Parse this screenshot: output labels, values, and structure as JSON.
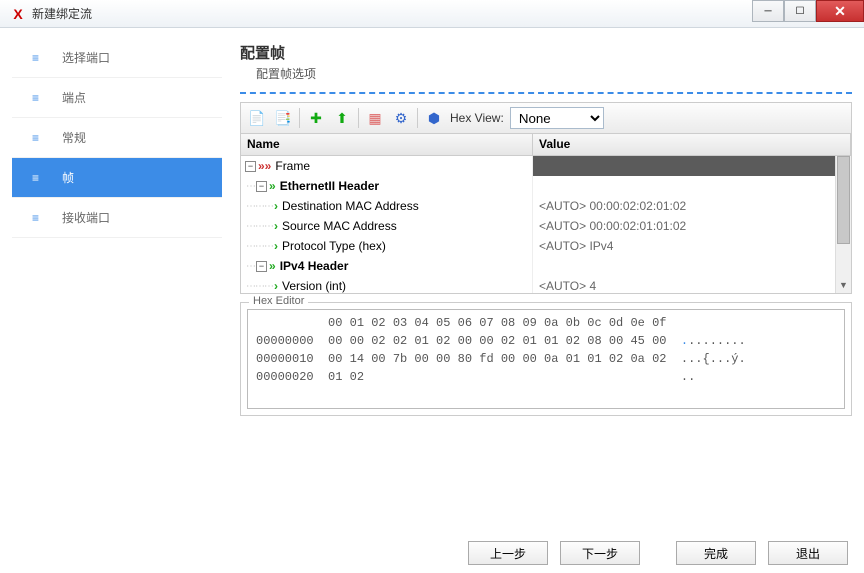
{
  "title": "新建绑定流",
  "sidebar": {
    "items": [
      {
        "label": "选择端口"
      },
      {
        "label": "端点"
      },
      {
        "label": "常规"
      },
      {
        "label": "帧"
      },
      {
        "label": "接收端口"
      }
    ],
    "active_index": 3
  },
  "main": {
    "title": "配置帧",
    "subtitle": "配置帧选项",
    "hexview_label": "Hex View:",
    "hexview_value": "None"
  },
  "tree": {
    "headers": {
      "name": "Name",
      "value": "Value"
    },
    "rows": [
      {
        "depth": 0,
        "exp": "-",
        "arrow": "red",
        "label": "Frame",
        "bold": false,
        "value": "",
        "selected": true
      },
      {
        "depth": 1,
        "exp": "-",
        "arrow": "green",
        "label": "EthernetII Header",
        "bold": true,
        "value": ""
      },
      {
        "depth": 2,
        "exp": "",
        "arrow": "green-small",
        "label": "Destination MAC Address",
        "bold": false,
        "value": "<AUTO> 00:00:02:02:01:02"
      },
      {
        "depth": 2,
        "exp": "",
        "arrow": "green-small",
        "label": "Source MAC Address",
        "bold": false,
        "value": "<AUTO> 00:00:02:01:01:02"
      },
      {
        "depth": 2,
        "exp": "",
        "arrow": "green-small",
        "label": "Protocol Type (hex)",
        "bold": false,
        "value": "<AUTO> IPv4"
      },
      {
        "depth": 1,
        "exp": "-",
        "arrow": "green",
        "label": "IPv4 Header",
        "bold": true,
        "value": ""
      },
      {
        "depth": 2,
        "exp": "",
        "arrow": "green-small",
        "label": "Version (int)",
        "bold": false,
        "value": "<AUTO> 4"
      }
    ]
  },
  "hex": {
    "legend": "Hex Editor",
    "header_cols": "          00 01 02 03 04 05 06 07 08 09 0a 0b 0c 0d 0e 0f",
    "rows": [
      {
        "addr": "00000000",
        "bytes": "00 00 02 02 01 02 00 00 02 01 01 02 08 00 45 00",
        "ascii": ".",
        "ascii_rest": "........"
      },
      {
        "addr": "00000010",
        "bytes": "00 14 00 7b 00 00 80 fd 00 00 0a 01 01 02 0a 02",
        "ascii": "",
        "ascii_rest": "...{...ý."
      },
      {
        "addr": "00000020",
        "bytes": "01 02                                          ",
        "ascii": "",
        "ascii_rest": ".."
      }
    ]
  },
  "footer": {
    "prev": "上一步",
    "next": "下一步",
    "finish": "完成",
    "exit": "退出"
  }
}
